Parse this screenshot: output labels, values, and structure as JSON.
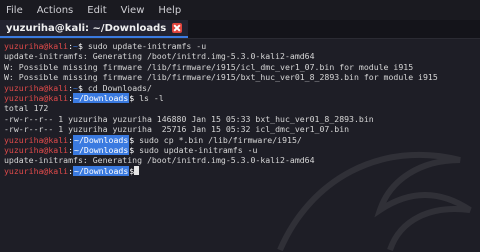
{
  "menu": {
    "items": [
      "File",
      "Actions",
      "Edit",
      "View",
      "Help"
    ]
  },
  "tab": {
    "title": "yuzuriha@kali: ~/Downloads"
  },
  "prompt": {
    "user": "yuzuriha@kali",
    "colon": ":",
    "home_dir": "~",
    "downloads_dir": "~/Downloads",
    "symbol": "$"
  },
  "terminal": {
    "lines": [
      {
        "type": "prompt",
        "dir": "~",
        "cmd": " sudo update-initramfs -u"
      },
      {
        "type": "output",
        "text": "update-initramfs: Generating /boot/initrd.img-5.3.0-kali2-amd64"
      },
      {
        "type": "output",
        "text": "W: Possible missing firmware /lib/firmware/i915/icl_dmc_ver1_07.bin for module i915"
      },
      {
        "type": "output",
        "text": "W: Possible missing firmware /lib/firmware/i915/bxt_huc_ver01_8_2893.bin for module i915"
      },
      {
        "type": "prompt",
        "dir": "~",
        "cmd": " cd Downloads/"
      },
      {
        "type": "prompt",
        "dir": "~/Downloads",
        "cmd": " ls -l"
      },
      {
        "type": "output",
        "text": "total 172"
      },
      {
        "type": "output",
        "text": "-rw-r--r-- 1 yuzuriha yuzuriha 146880 Jan 15 05:33 bxt_huc_ver01_8_2893.bin"
      },
      {
        "type": "output",
        "text": "-rw-r--r-- 1 yuzuriha yuzuriha  25716 Jan 15 05:32 icl_dmc_ver1_07.bin"
      },
      {
        "type": "prompt",
        "dir": "~/Downloads",
        "cmd": " sudo cp *.bin /lib/firmware/i915/"
      },
      {
        "type": "prompt",
        "dir": "~/Downloads",
        "cmd": " sudo update-initramfs -u"
      },
      {
        "type": "output",
        "text": "update-initramfs: Generating /boot/initrd.img-5.3.0-kali2-amd64"
      },
      {
        "type": "prompt",
        "dir": "~/Downloads",
        "cmd": ""
      }
    ]
  },
  "colors": {
    "user": "#e04a4a",
    "dir_highlight": "#3a7ae0",
    "background": "#1e1e26",
    "text": "#d6d6d6"
  }
}
